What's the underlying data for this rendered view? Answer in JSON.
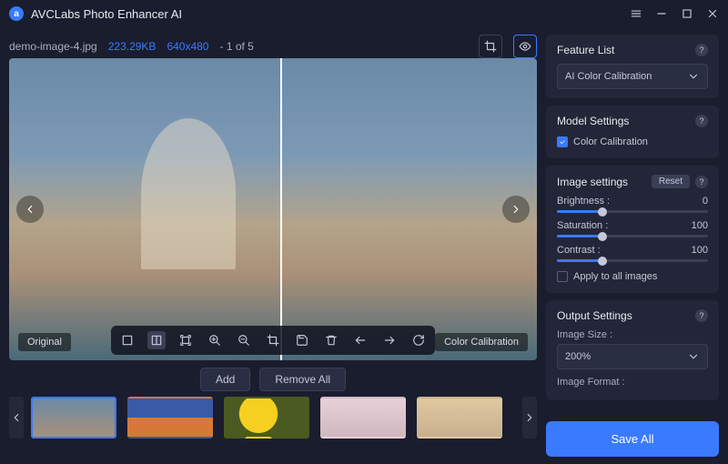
{
  "app": {
    "title": "AVCLabs Photo Enhancer AI"
  },
  "file_info": {
    "filename": "demo-image-4.jpg",
    "size": "223.29KB",
    "dimensions": "640x480",
    "index": "- 1 of 5"
  },
  "preview": {
    "label_original": "Original",
    "label_processed": "Color Calibration"
  },
  "thumb_buttons": {
    "add": "Add",
    "remove_all": "Remove All"
  },
  "feature_list": {
    "title": "Feature List",
    "selected": "AI Color Calibration"
  },
  "model_settings": {
    "title": "Model Settings",
    "option": "Color Calibration",
    "checked": true
  },
  "image_settings": {
    "title": "Image settings",
    "reset": "Reset",
    "brightness_label": "Brightness :",
    "brightness_value": "0",
    "brightness_pct": 30,
    "saturation_label": "Saturation :",
    "saturation_value": "100",
    "saturation_pct": 30,
    "contrast_label": "Contrast :",
    "contrast_value": "100",
    "contrast_pct": 30,
    "apply_all": "Apply to all images",
    "apply_all_checked": false
  },
  "output": {
    "title": "Output Settings",
    "size_label": "Image Size :",
    "size_value": "200%",
    "format_label": "Image Format :"
  },
  "save": "Save All"
}
